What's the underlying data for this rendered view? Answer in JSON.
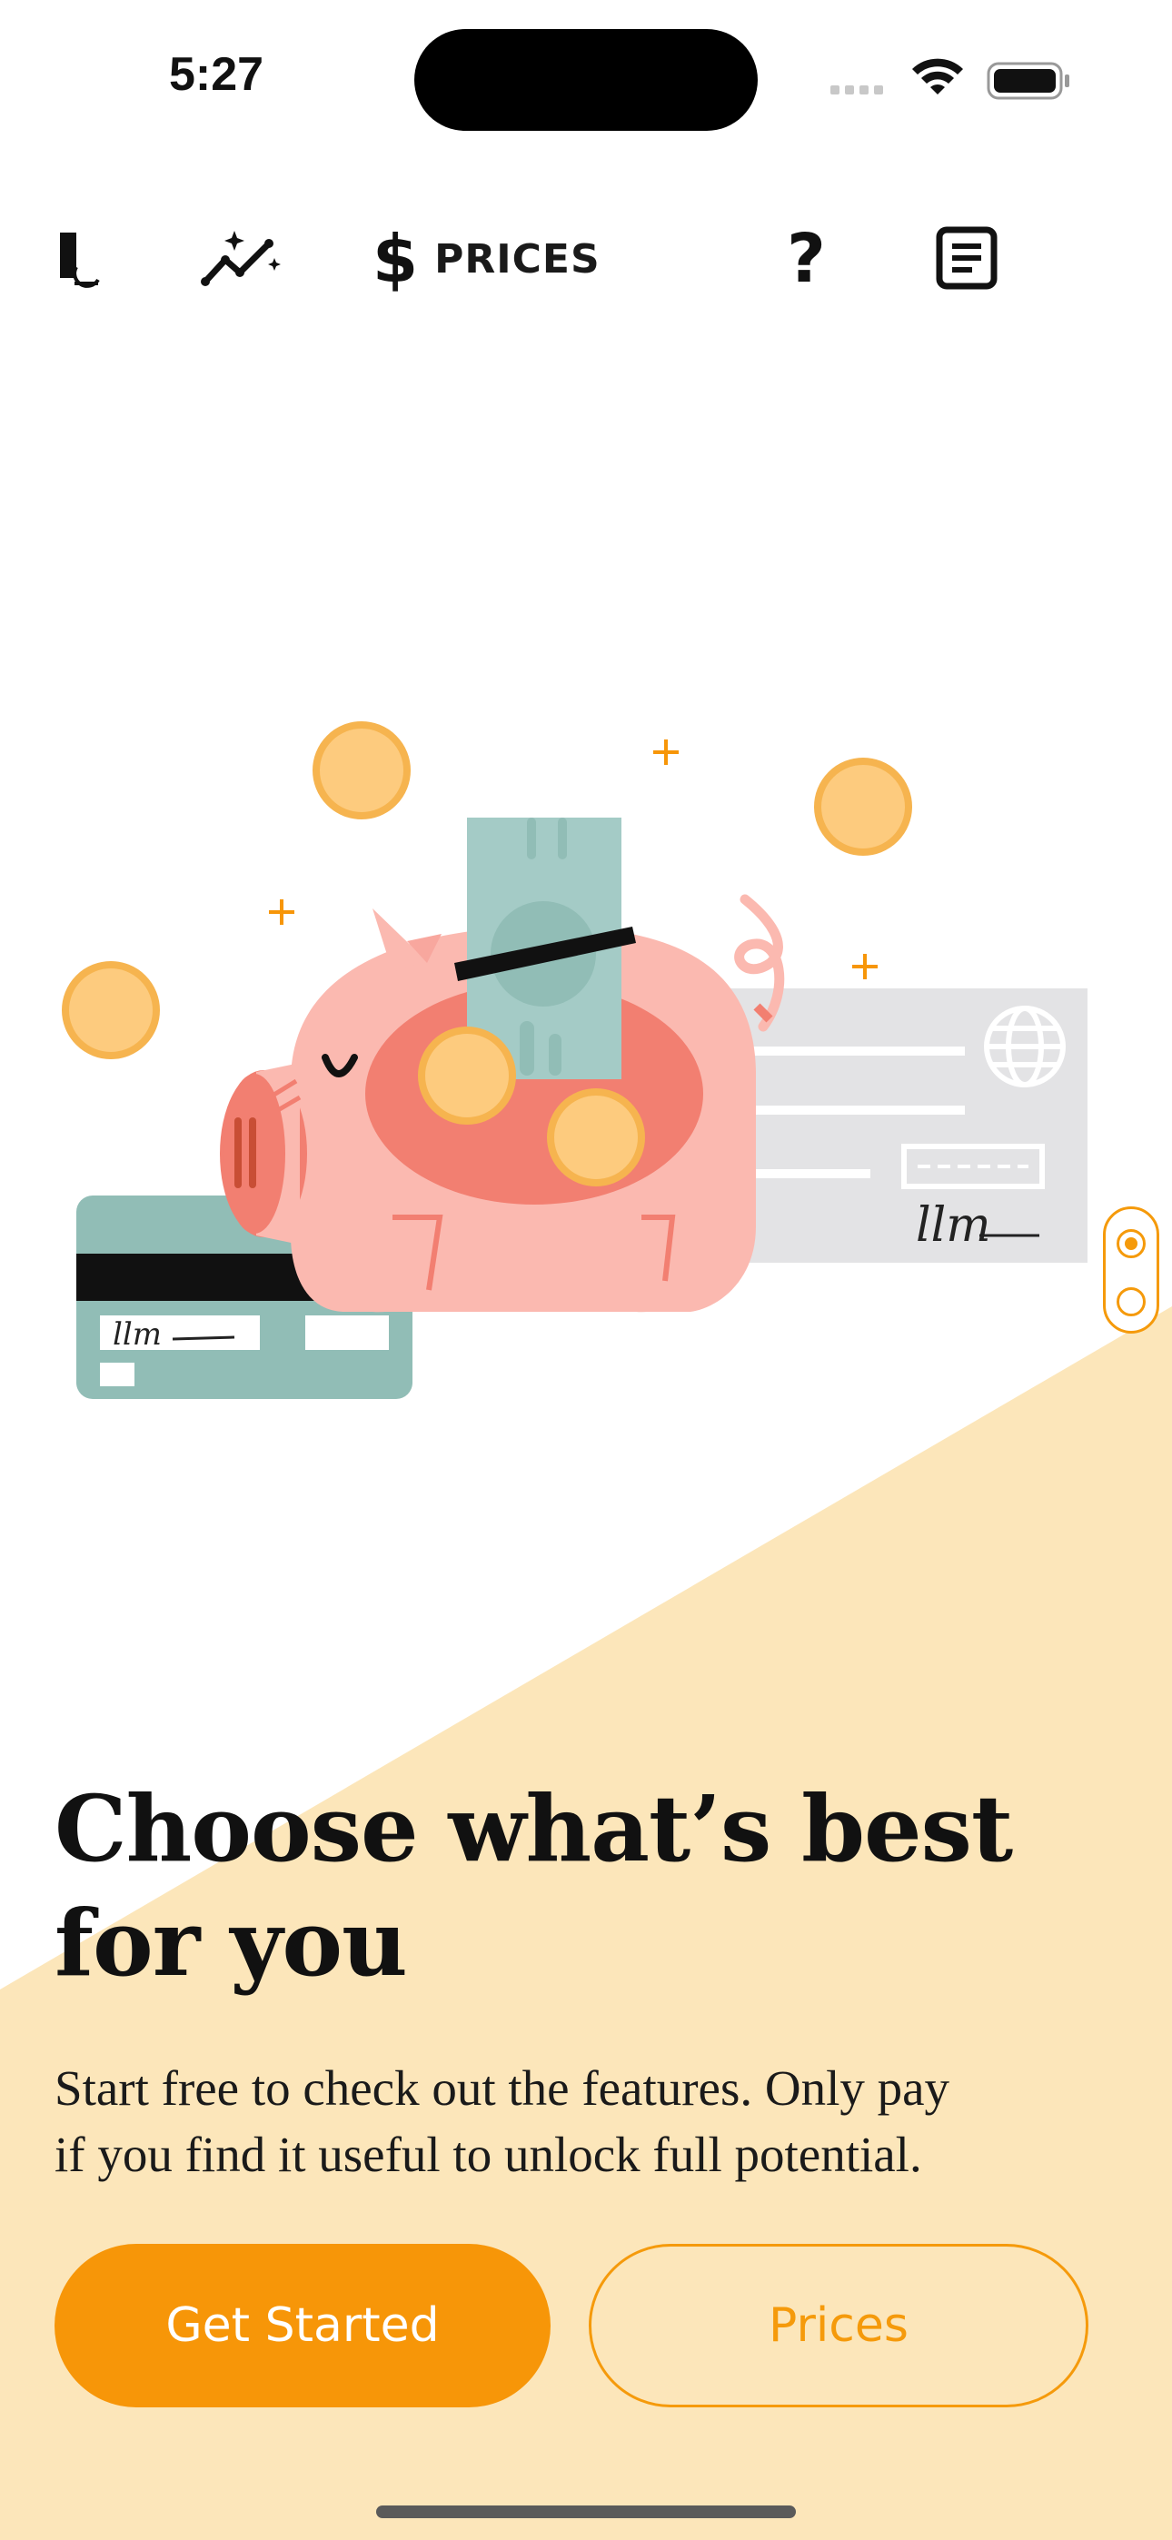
{
  "status_bar": {
    "time": "5:27"
  },
  "nav": {
    "logo_icon": "logo-l-icon",
    "insights_icon": "sparkle-chart-icon",
    "prices_icon": "dollar-icon",
    "prices_label": "PRICES",
    "help_icon": "question-icon",
    "document_icon": "document-icon"
  },
  "illustration": {
    "check_signature": "llm",
    "card_signature": "llm"
  },
  "content": {
    "headline_line1": "Choose what’s best",
    "headline_line2": "for you",
    "subtext_line1": "Start free to check out the features. Only pay",
    "subtext_line2": "if you find it useful to unlock full potential."
  },
  "buttons": {
    "get_started": "Get Started",
    "prices": "Prices"
  },
  "colors": {
    "accent": "#f79608",
    "background_cream": "#fce6ba",
    "pig": "#fbb9b0",
    "pig_belly": "#f27f71",
    "card": "#91bdb6",
    "coin": "#fdcb7e"
  }
}
